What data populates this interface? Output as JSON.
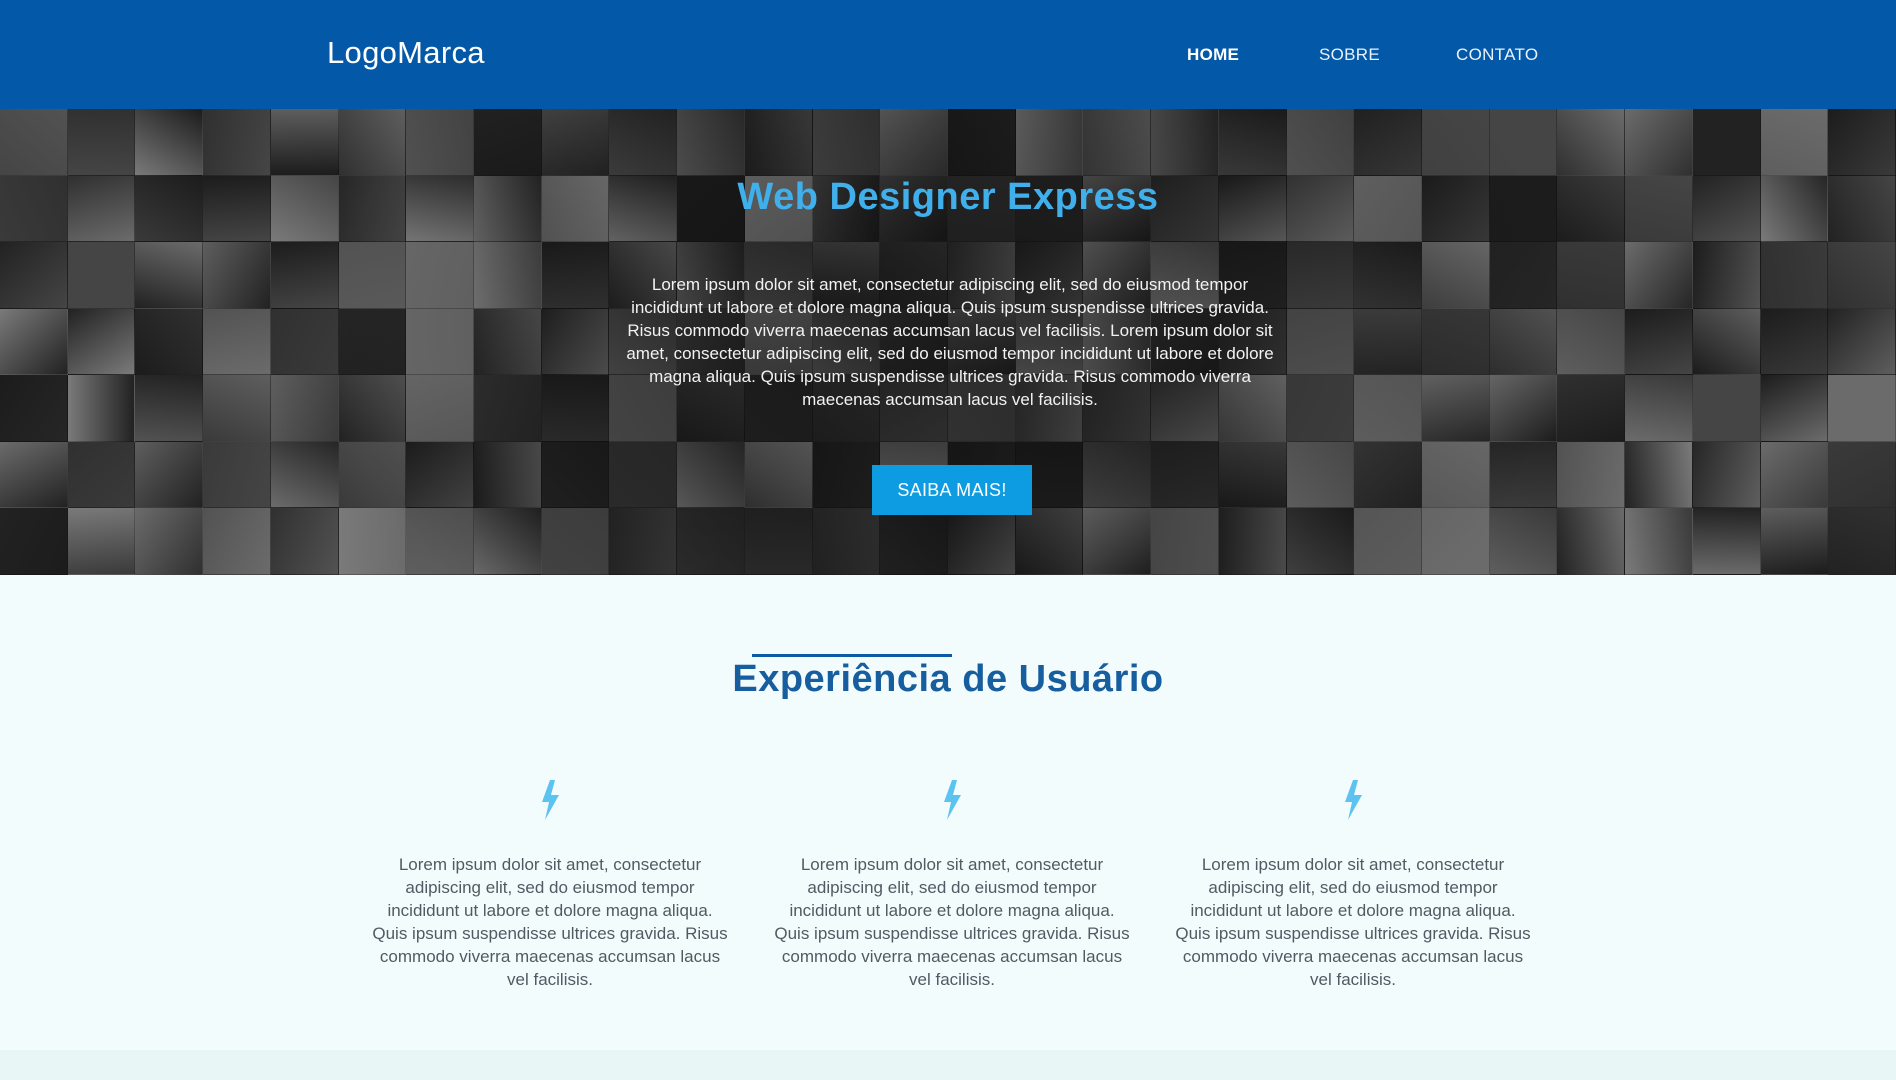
{
  "header": {
    "logo": "LogoMarca",
    "nav": [
      {
        "label": "HOME",
        "active": true
      },
      {
        "label": "SOBRE",
        "active": false
      },
      {
        "label": "CONTATO",
        "active": false
      }
    ]
  },
  "hero": {
    "title": "Web Designer Express",
    "text": "Lorem ipsum dolor sit amet, consectetur adipiscing elit, sed do eiusmod tempor incididunt ut labore et dolore magna aliqua. Quis ipsum suspendisse ultrices gravida. Risus commodo viverra maecenas accumsan lacus vel facilisis. Lorem ipsum dolor sit amet, consectetur adipiscing elit, sed do eiusmod tempor incididunt ut labore et dolore magna aliqua. Quis ipsum suspendisse ultrices gravida. Risus commodo viverra maecenas accumsan lacus vel facilisis.",
    "button_label": "SAIBA MAIS!"
  },
  "features": {
    "title": "Experiência de Usuário",
    "items": [
      {
        "icon": "lightning-bolt-icon",
        "text": "Lorem ipsum dolor sit amet, consectetur adipiscing elit, sed do eiusmod tempor incididunt ut labore et dolore magna aliqua. Quis ipsum suspendisse ultrices gravida. Risus commodo viverra maecenas accumsan lacus vel facilisis."
      },
      {
        "icon": "lightning-bolt-icon",
        "text": "Lorem ipsum dolor sit amet, consectetur adipiscing elit, sed do eiusmod tempor incididunt ut labore et dolore magna aliqua. Quis ipsum suspendisse ultrices gravida. Risus commodo viverra maecenas accumsan lacus vel facilisis."
      },
      {
        "icon": "lightning-bolt-icon",
        "text": "Lorem ipsum dolor sit amet, consectetur adipiscing elit, sed do eiusmod tempor incididunt ut labore et dolore magna aliqua. Quis ipsum suspendisse ultrices gravida. Risus commodo viverra maecenas accumsan lacus vel facilisis."
      }
    ]
  },
  "colors": {
    "header_bg": "#0458a8",
    "hero_title": "#3fb0ec",
    "button_bg": "#0d9be1",
    "section_title": "#175e9f",
    "icon": "#5cc3f0",
    "section_bg": "#f3fcfd"
  }
}
